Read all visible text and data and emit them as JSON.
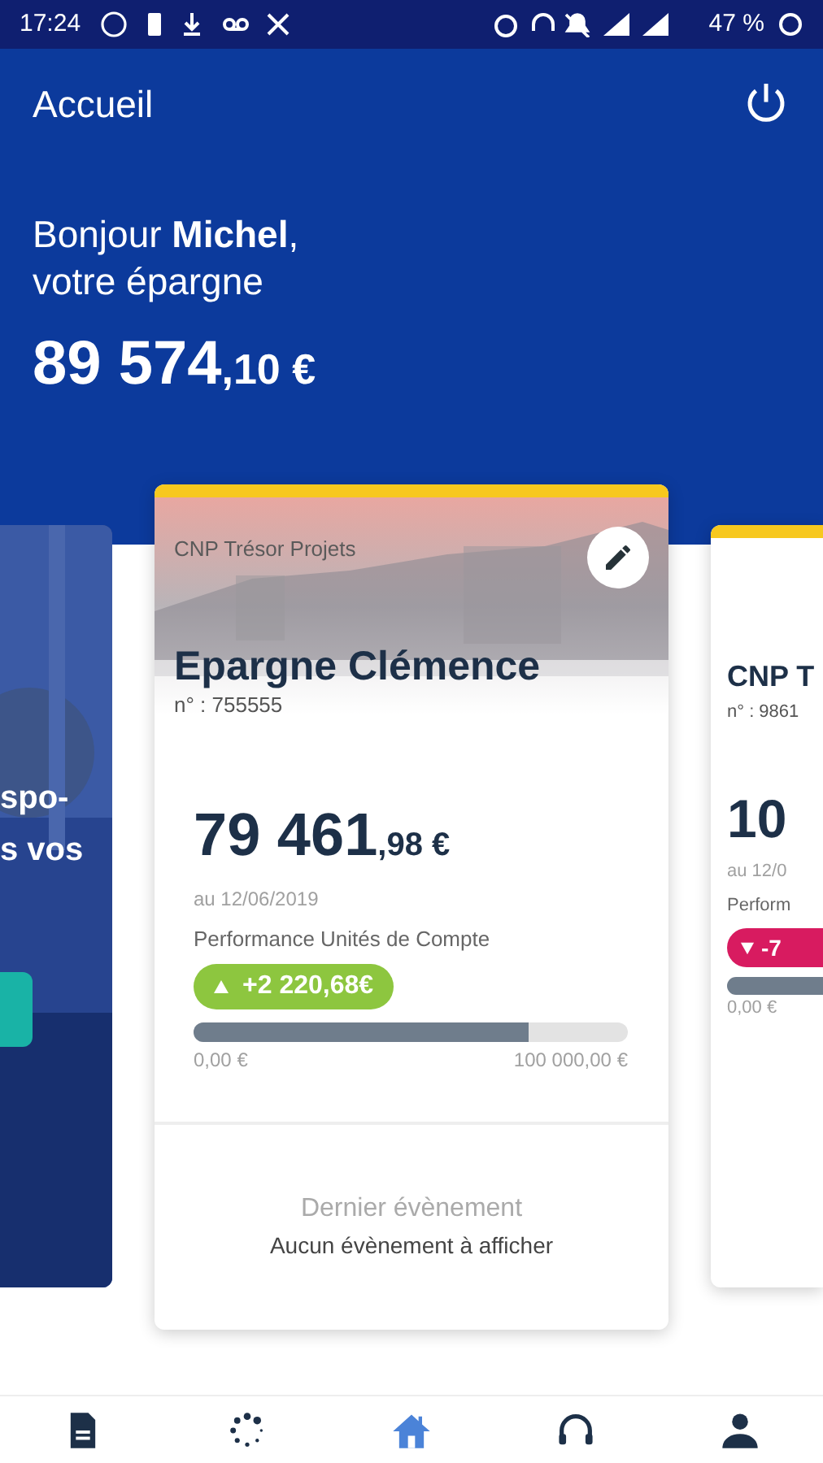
{
  "status_bar": {
    "time": "17:24",
    "battery": "47 %"
  },
  "header": {
    "title": "Accueil"
  },
  "greeting": {
    "line1": "Bonjour **Michel**,",
    "line2": "votre épargne"
  },
  "total": {
    "whole": "89 574",
    "decimals": ",10 €"
  },
  "left_card": {
    "lines": [
      "spo-",
      "s vos"
    ]
  },
  "main_card": {
    "product": "CNP Trésor Projets",
    "name": "Epargne Clémence",
    "number": "n° : 755555",
    "amount_whole": "79 461",
    "amount_decimals": ",98 €",
    "date": "au 12/06/2019",
    "performance_label": "Performance Unités de Compte",
    "performance": "+2 220,68€",
    "kind": "gain",
    "level": 0.77,
    "min": "0,00 €",
    "max": "100 000,00 €",
    "event_title": "Dernier évènement",
    "event_text": "Aucun évènement à afficher"
  },
  "right_card": {
    "name": "CNP T",
    "number": "n° : 9861",
    "amount": "10",
    "date": "au 12/0",
    "performance_label": "Perform",
    "performance": "-7",
    "kind": "loss",
    "min": "0,00 €"
  },
  "nav": [
    {
      "kind": "document",
      "selected": false
    },
    {
      "kind": "spinner",
      "selected": false
    },
    {
      "kind": "home",
      "selected": true
    },
    {
      "kind": "headset",
      "selected": false
    },
    {
      "kind": "person",
      "selected": false
    }
  ]
}
